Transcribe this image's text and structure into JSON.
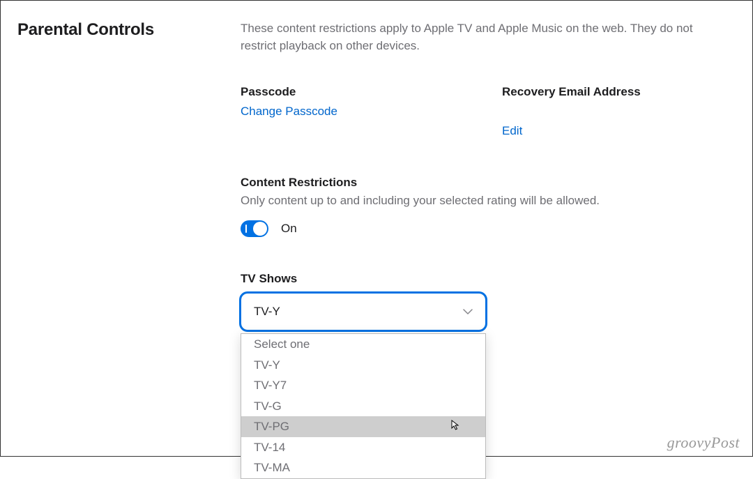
{
  "page": {
    "title": "Parental Controls",
    "description": "These content restrictions apply to Apple TV and Apple Music on the web. They do not restrict playback on other devices."
  },
  "passcode": {
    "label": "Passcode",
    "change_link": "Change Passcode"
  },
  "recovery": {
    "label": "Recovery Email Address",
    "value": "",
    "edit_link": "Edit"
  },
  "restrictions": {
    "title": "Content Restrictions",
    "description": "Only content up to and including your selected rating will be allowed.",
    "toggle_state": "On"
  },
  "tv_shows": {
    "label": "TV Shows",
    "selected": "TV-Y",
    "options": [
      {
        "label": "Select one",
        "highlighted": false
      },
      {
        "label": "TV-Y",
        "highlighted": false
      },
      {
        "label": "TV-Y7",
        "highlighted": false
      },
      {
        "label": "TV-G",
        "highlighted": false
      },
      {
        "label": "TV-PG",
        "highlighted": true
      },
      {
        "label": "TV-14",
        "highlighted": false
      },
      {
        "label": "TV-MA",
        "highlighted": false
      }
    ]
  },
  "watermark": "groovyPost"
}
